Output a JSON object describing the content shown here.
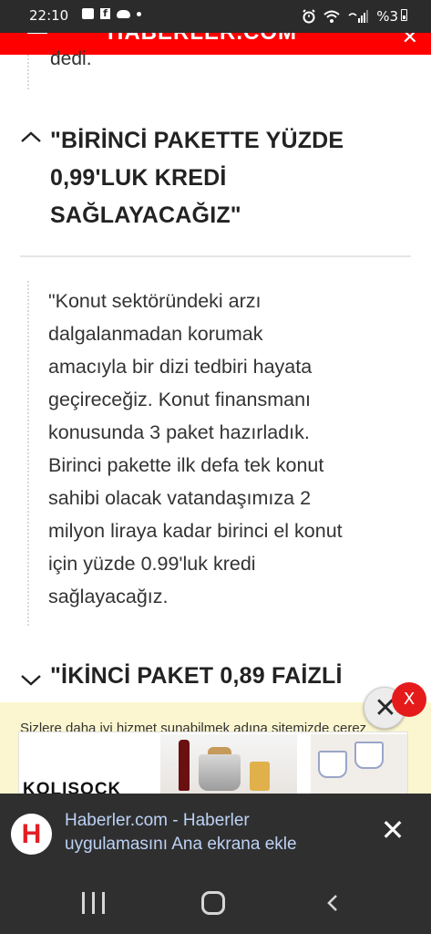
{
  "status_bar": {
    "time": "22:10",
    "battery_text": "%3",
    "icons": [
      "gallery-icon",
      "facebook-icon",
      "cloud-icon",
      "dot-icon",
      "alarm-icon",
      "wifi-icon",
      "signal-icon",
      "battery-icon"
    ]
  },
  "header": {
    "logo": "HABERLER.COM"
  },
  "article": {
    "prev_tail": "dedi.",
    "section1_heading_lines": [
      "\"BİRİNCİ PAKETTE YÜZDE",
      "0,99'LUK KREDİ",
      "SAĞLAYACAĞIZ\""
    ],
    "section1_paragraph_lines": [
      "\"Konut sektöründeki arzı",
      "dalgalanmadan korumak",
      "amacıyla bir dizi tedbiri hayata",
      "geçireceğiz. Konut finansmanı",
      "konusunda 3 paket hazırladık.",
      "Birinci pakette ilk defa tek konut",
      "sahibi olacak vatandaşımıza 2",
      "milyon liraya kadar birinci el konut",
      "için yüzde 0.99'luk kredi",
      "sağlayacağız."
    ],
    "section2_heading": "\"İKİNCİ PAKET 0,89 FAİZLİ"
  },
  "cookie_notice": {
    "text": "Sizlere daha iyi hizmet sunabilmek adına sitemizde çerez"
  },
  "ad": {
    "brand": "KOLISOCK",
    "close_glyph": "✕",
    "badge_glyph": "X"
  },
  "app_banner": {
    "icon_letter": "H",
    "line1": "Haberler.com - Haberler",
    "line2": "uygulamasını Ana ekrana ekle",
    "close_glyph": "✕"
  },
  "colors": {
    "header_red": "#ff0000",
    "banner_bg": "#2f2f2f",
    "banner_text": "#bcd2f5",
    "ad_strip_bg": "#fbf6cf"
  }
}
